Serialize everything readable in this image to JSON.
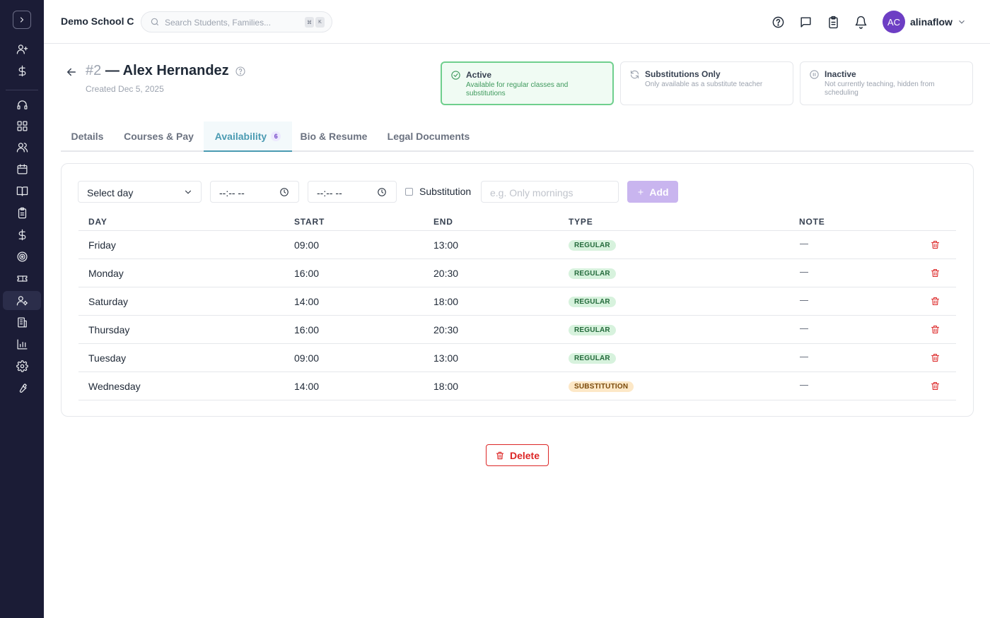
{
  "sidebar": {
    "toggle_icon": "chevron-right-icon",
    "items": [
      {
        "icon": "user-plus-icon"
      },
      {
        "icon": "dollar-icon"
      },
      {
        "icon": "headset-icon"
      },
      {
        "icon": "dashboard-grid-icon"
      },
      {
        "icon": "users-icon"
      },
      {
        "icon": "calendar-icon"
      },
      {
        "icon": "book-icon"
      },
      {
        "icon": "clipboard-icon"
      },
      {
        "icon": "dollar-icon"
      },
      {
        "icon": "target-icon"
      },
      {
        "icon": "ticket-icon"
      },
      {
        "icon": "user-cog-icon",
        "active": true
      },
      {
        "icon": "building-icon"
      },
      {
        "icon": "bar-chart-icon"
      },
      {
        "icon": "settings-gear-icon"
      },
      {
        "icon": "wrench-icon"
      }
    ]
  },
  "topbar": {
    "school_name": "Demo School C",
    "search_placeholder": "Search Students, Families...",
    "shortcut_keys": [
      "⌘",
      "K"
    ],
    "icons": [
      "help-icon",
      "chat-icon",
      "clipboard-icon",
      "bell-icon"
    ],
    "user": {
      "initials": "AC",
      "name": "alinaflow",
      "avatar_color": "#6d3ec4"
    }
  },
  "header": {
    "number": "#2",
    "name": "— Alex Hernandez",
    "created": "Created Dec 5, 2025"
  },
  "statuses": [
    {
      "title": "Active",
      "desc": "Available for regular classes and substitutions",
      "selected": true,
      "icon": "check-circle-icon"
    },
    {
      "title": "Substitutions Only",
      "desc": "Only available as a substitute teacher",
      "selected": false,
      "icon": "refresh-icon"
    },
    {
      "title": "Inactive",
      "desc": "Not currently teaching, hidden from scheduling",
      "selected": false,
      "icon": "pause-circle-icon"
    }
  ],
  "tabs": [
    {
      "label": "Details"
    },
    {
      "label": "Courses & Pay"
    },
    {
      "label": "Availability",
      "badge": "6",
      "active": true
    },
    {
      "label": "Bio & Resume"
    },
    {
      "label": "Legal Documents"
    }
  ],
  "form": {
    "day_select": "Select day",
    "start_time": "--:-- --",
    "end_time": "--:-- --",
    "substitution_label": "Substitution",
    "note_placeholder": "e.g. Only mornings",
    "add_label": "Add"
  },
  "table": {
    "columns": [
      "DAY",
      "START",
      "END",
      "TYPE",
      "NOTE"
    ],
    "rows": [
      {
        "day": "Friday",
        "start": "09:00",
        "end": "13:00",
        "type": "REGULAR"
      },
      {
        "day": "Monday",
        "start": "16:00",
        "end": "20:30",
        "type": "REGULAR"
      },
      {
        "day": "Saturday",
        "start": "14:00",
        "end": "18:00",
        "type": "REGULAR"
      },
      {
        "day": "Thursday",
        "start": "16:00",
        "end": "20:30",
        "type": "REGULAR"
      },
      {
        "day": "Tuesday",
        "start": "09:00",
        "end": "13:00",
        "type": "REGULAR"
      },
      {
        "day": "Wednesday",
        "start": "14:00",
        "end": "18:00",
        "type": "SUBSTITUTION"
      }
    ]
  },
  "delete_label": "Delete",
  "colors": {
    "sidebar_bg": "#1b1c36",
    "accent_teal": "#4b9bb2",
    "active_green": "#6fcf8d",
    "danger_red": "#dc2626",
    "add_purple": "#c9b5ef"
  }
}
